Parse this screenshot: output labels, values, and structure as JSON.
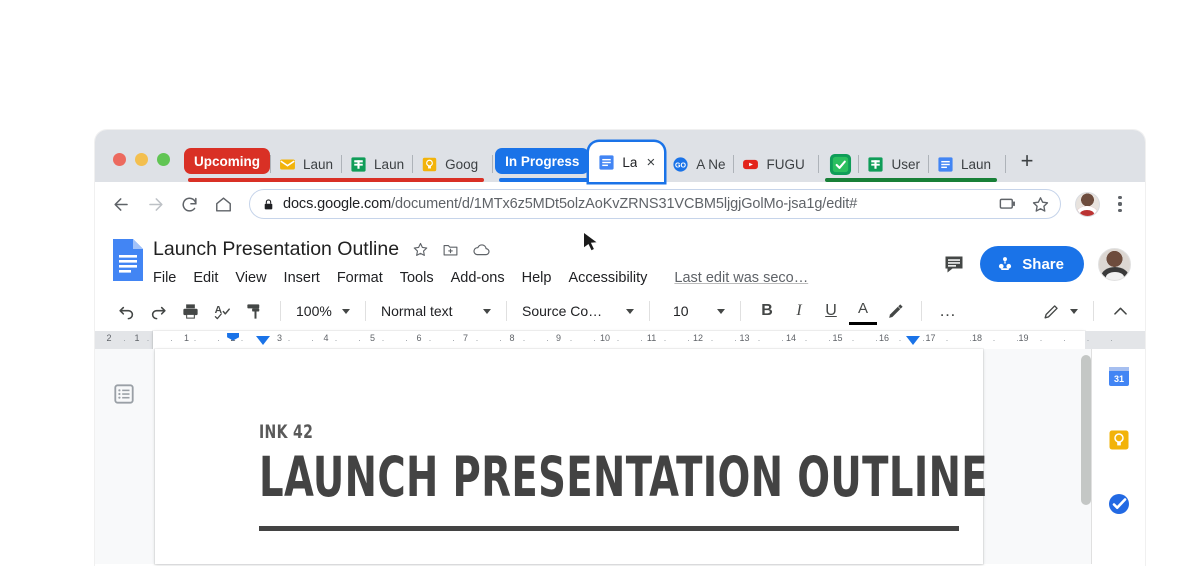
{
  "browser": {
    "window_controls": [
      "close",
      "minimize",
      "zoom"
    ],
    "tab_groups": [
      {
        "label": "Upcoming",
        "color": "#d93025"
      },
      {
        "label": "In Progress",
        "color": "#1a73e8"
      },
      {
        "label": "",
        "color": "#188038"
      }
    ],
    "tabs": [
      {
        "title": "Laun",
        "icon": "gmail-icon",
        "active": false
      },
      {
        "title": "Laun",
        "icon": "sheets-icon",
        "active": false
      },
      {
        "title": "Goog",
        "icon": "keep-icon",
        "active": false
      },
      {
        "title": "La",
        "icon": "docs-icon",
        "active": true,
        "close": "×"
      },
      {
        "title": "A Ne",
        "icon": "go-icon",
        "active": false
      },
      {
        "title": "FUGU",
        "icon": "youtube-icon",
        "active": false
      },
      {
        "title": "",
        "icon": "tasks-green-icon",
        "active": false
      },
      {
        "title": "User",
        "icon": "sheets-icon",
        "active": false
      },
      {
        "title": "Laun",
        "icon": "docs-icon",
        "active": false
      }
    ],
    "new_tab_label": "+",
    "nav": {
      "back": "back-arrow",
      "forward": "forward-arrow",
      "reload": "reload-arrow",
      "home": "home-house"
    },
    "omnibox": {
      "lock": "lock-icon",
      "url_domain": "docs.google.com",
      "url_path": "/document/d/1MTx6z5MDt5olzAoKvZRNS31VCBM5ljgjGolMo-jsa1g/edit#",
      "cast_icon": "cast-icon",
      "bookmark_icon": "star-icon"
    },
    "profile_icon": "profile-avatar",
    "menu_icon": "three-dot-menu-icon"
  },
  "docs": {
    "app_icon": "google-docs-icon",
    "title": "Launch Presentation Outline",
    "title_actions": [
      {
        "name": "star-icon"
      },
      {
        "name": "move-to-folder-icon"
      },
      {
        "name": "cloud-saved-icon"
      }
    ],
    "menus": [
      "File",
      "Edit",
      "View",
      "Insert",
      "Format",
      "Tools",
      "Add-ons",
      "Help",
      "Accessibility"
    ],
    "last_edit": "Last edit was seco…",
    "comment_icon": "comment-history-icon",
    "share_label": "Share",
    "share_icon": "share-person-icon",
    "account_avatar": "account-avatar"
  },
  "toolbar": {
    "undo": "undo-icon",
    "redo": "redo-icon",
    "print": "print-icon",
    "spellcheck": "spellcheck-icon",
    "paint_format": "paint-format-icon",
    "zoom_value": "100%",
    "style_value": "Normal text",
    "font_value": "Source Co…",
    "font_size_value": "10",
    "bold": "B",
    "italic": "I",
    "underline": "U",
    "text_color": "A",
    "highlight": "highlight-pen-icon",
    "more": "…",
    "editing_mode": "pencil-icon",
    "collapse": "collapse-chevron-icon"
  },
  "ruler": {
    "margin_ticks": [
      "2",
      "1"
    ],
    "page_ticks": [
      "1",
      "2",
      "3",
      "4",
      "5",
      "6",
      "7",
      "8",
      "9",
      "10",
      "11",
      "12",
      "13",
      "14",
      "15",
      "16",
      "17",
      "18",
      "19"
    ],
    "indent_marker_at": "2",
    "right_indent_at": "17"
  },
  "document": {
    "outline_toggle": "document-outline-icon",
    "kicker": "INK 42",
    "heading": "LAUNCH PRESENTATION OUTLINE"
  },
  "side_panel": {
    "items": [
      {
        "name": "google-calendar-icon",
        "label": "31"
      },
      {
        "name": "google-keep-icon",
        "label": ""
      },
      {
        "name": "google-tasks-icon",
        "label": ""
      }
    ]
  },
  "cursor": {
    "name": "mouse-pointer"
  }
}
